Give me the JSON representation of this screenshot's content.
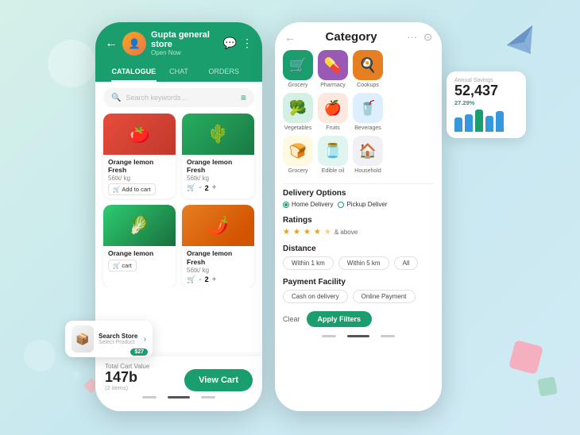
{
  "store": {
    "name": "Gupta general store",
    "status": "Open Now",
    "avatar_emoji": "👤"
  },
  "tabs": [
    {
      "label": "CATALOGUE",
      "active": true
    },
    {
      "label": "CHAT",
      "active": false
    },
    {
      "label": "ORDERS",
      "active": false
    }
  ],
  "search": {
    "placeholder": "Search keywords..."
  },
  "products": [
    {
      "name": "Orange lemon Fresh",
      "price": "56tk/ kg",
      "action": "add",
      "action_label": "Add to cart"
    },
    {
      "name": "Orange lemon Fresh",
      "price": "56tk/ kg",
      "action": "qty",
      "qty": 2
    },
    {
      "name": "Orange lemon",
      "price": "",
      "action": "add",
      "action_label": "cart"
    },
    {
      "name": "Orange lemon Fresh",
      "price": "56tk/ kg",
      "action": "qty",
      "qty": 2
    },
    {
      "name": "",
      "price": "",
      "action": "none"
    },
    {
      "name": "",
      "price": "",
      "action": "none"
    }
  ],
  "cart": {
    "total_label": "Total Cart Value",
    "total_value": "147b",
    "items_label": "(2 items)",
    "view_cart_label": "View Cart"
  },
  "floating_card": {
    "title": "Search Store",
    "sub": "Select Product",
    "price": "$27",
    "arrow": "›"
  },
  "right_phone": {
    "title": "Category",
    "header_icons": [
      "···",
      "⊙"
    ]
  },
  "categories_row1": [
    {
      "label": "Grocery",
      "emoji": "🛒",
      "color": "green"
    },
    {
      "label": "Pharmacy",
      "emoji": "💊",
      "color": "purple"
    },
    {
      "label": "Cookups",
      "emoji": "🍳",
      "color": "orange"
    }
  ],
  "categories_row2": [
    {
      "label": "Vegetables",
      "emoji": "🥦",
      "color": "light-green"
    },
    {
      "label": "Fruits",
      "emoji": "🍎",
      "color": "light-red"
    },
    {
      "label": "Beverages",
      "emoji": "🥤",
      "color": "light-blue"
    }
  ],
  "categories_row3": [
    {
      "label": "Grocery",
      "emoji": "🍞",
      "color": "light-yellow"
    },
    {
      "label": "Edible oil",
      "emoji": "🫙",
      "color": "light-teal"
    },
    {
      "label": "Household",
      "emoji": "🏠",
      "color": "light-gray"
    }
  ],
  "delivery_options": [
    {
      "label": "Home Delivery",
      "selected": true
    },
    {
      "label": "Pickup Deliver",
      "selected": false
    }
  ],
  "ratings": {
    "label": "& above",
    "value": 4,
    "max": 5
  },
  "distance_options": [
    {
      "label": "Within 1 km",
      "selected": false
    },
    {
      "label": "Within 5 km",
      "selected": false
    },
    {
      "label": "All",
      "selected": false
    }
  ],
  "payment_options": [
    {
      "label": "Cash on delivery",
      "selected": false
    },
    {
      "label": "Online Payment",
      "selected": false
    }
  ],
  "filter_actions": {
    "clear_label": "Clear",
    "apply_label": "Apply Filters"
  },
  "stats": {
    "label": "Annual Savings",
    "value": "52,437",
    "change": "27.29%",
    "bars": [
      18,
      22,
      28,
      20,
      26
    ]
  },
  "sections": {
    "delivery_title": "Delivery Options",
    "ratings_title": "Ratings",
    "distance_title": "Distance",
    "payment_title": "Payment Facility"
  }
}
